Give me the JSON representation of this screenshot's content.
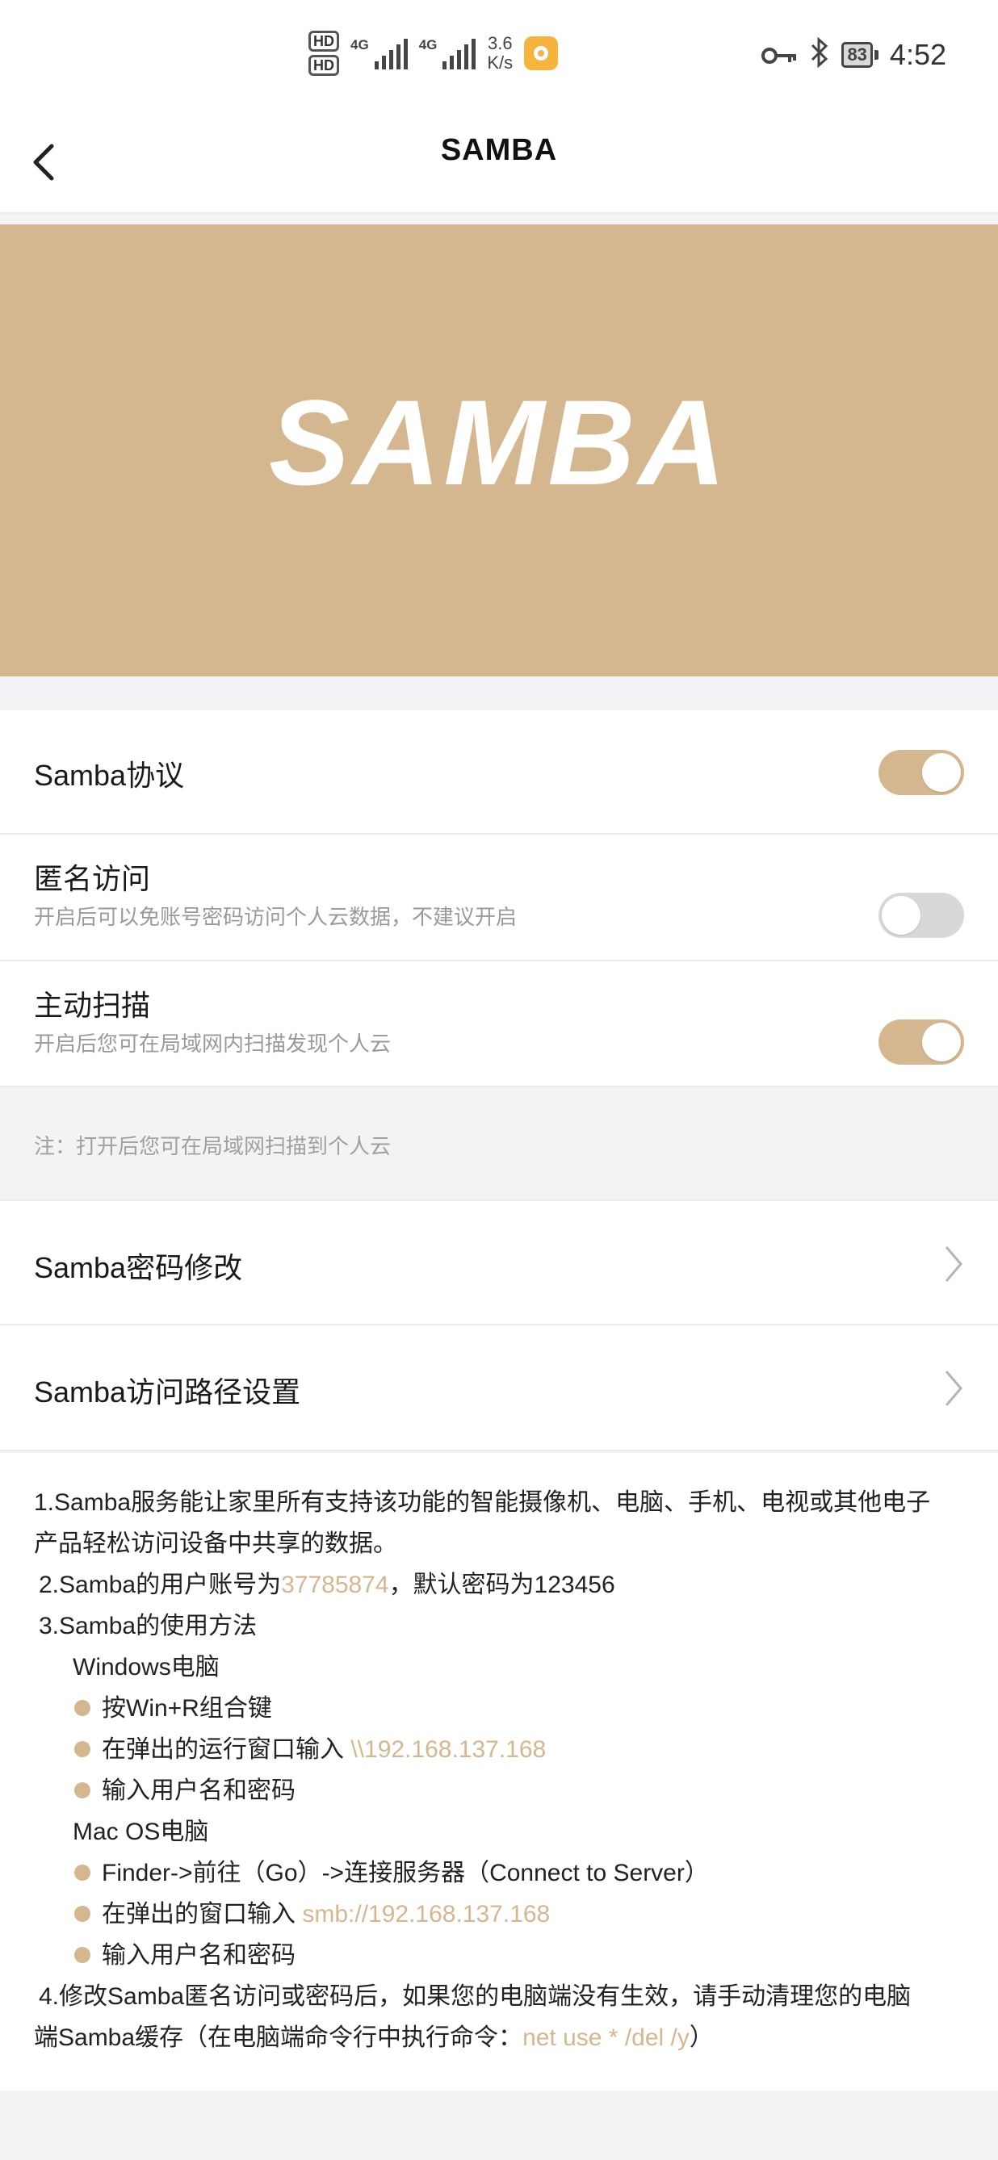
{
  "status_bar": {
    "hd1": "HD",
    "hd2": "HD",
    "sim1_label": "4G",
    "sim2_label": "4G",
    "net_speed_value": "3.6",
    "net_speed_unit": "K/s",
    "battery": "83",
    "time": "4:52",
    "icons": [
      "hd-icon",
      "signal-icon",
      "app-notification-icon",
      "key-icon",
      "bluetooth-icon",
      "battery-icon"
    ]
  },
  "nav": {
    "title": "SAMBA",
    "back_icon": "chevron-left-icon"
  },
  "banner": {
    "logo_text": "SAMBA"
  },
  "settings": {
    "samba_protocol": {
      "title": "Samba协议",
      "enabled": true
    },
    "anonymous_access": {
      "title": "匿名访问",
      "subtitle": "开启后可以免账号密码访问个人云数据，不建议开启",
      "enabled": false
    },
    "active_scan": {
      "title": "主动扫描",
      "subtitle": "开启后您可在局域网内扫描发现个人云",
      "enabled": true
    },
    "note": "注：打开后您可在局域网扫描到个人云"
  },
  "menu": {
    "password": "Samba密码修改",
    "path": "Samba访问路径设置"
  },
  "description": {
    "p1_line1": "1.Samba服务能让家里所有支持该功能的智能摄像机、电脑、手机、电视或其他电子",
    "p1_line2": "产品轻松访问设备中共享的数据。",
    "p2_prefix": "2.Samba的用户账号为",
    "p2_account": "37785874",
    "p2_suffix": "，默认密码为123456",
    "p3_title": "3.Samba的使用方法",
    "windows_title": "Windows电脑",
    "win_step1": "按Win+R组合键",
    "win_step2_prefix": "在弹出的运行窗口输入 ",
    "win_step2_value": "\\\\192.168.137.168",
    "win_step3": "输入用户名和密码",
    "mac_title": "Mac OS电脑",
    "mac_step1": "Finder->前往（Go）->连接服务器（Connect to Server）",
    "mac_step2_prefix": "在弹出的窗口输入 ",
    "mac_step2_value": "smb://192.168.137.168",
    "mac_step3": "输入用户名和密码",
    "p4_line1": "4.修改Samba匿名访问或密码后，如果您的电脑端没有生效，请手动清理您的电脑",
    "p4_line2_prefix": "端Samba缓存（在电脑端命令行中执行命令：",
    "p4_line2_cmd": "net use * /del /y",
    "p4_line2_suffix": "）"
  },
  "colors": {
    "accent": "#d5b78f",
    "background": "#f3f3f5",
    "toggle_off": "#d8d8d8"
  }
}
